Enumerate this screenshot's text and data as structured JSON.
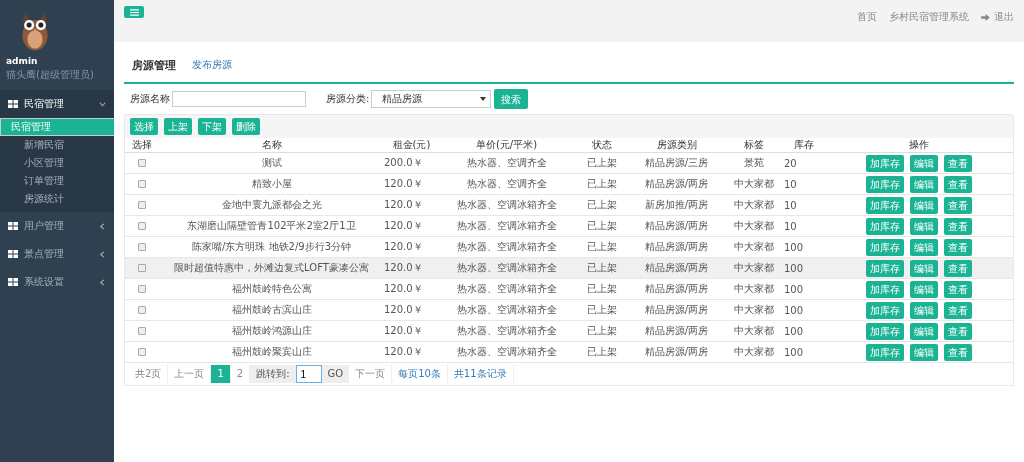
{
  "sidebar": {
    "user": {
      "name": "admin",
      "role": "猫头鹰(超级管理员)"
    },
    "menu": [
      {
        "label": "民宿管理",
        "expanded": true,
        "children": [
          {
            "label": "民宿管理",
            "selected": true
          },
          {
            "label": "新增民宿",
            "selected": false
          },
          {
            "label": "小区管理",
            "selected": false
          },
          {
            "label": "订单管理",
            "selected": false
          },
          {
            "label": "房源统计",
            "selected": false
          }
        ]
      },
      {
        "label": "用户管理",
        "expanded": false
      },
      {
        "label": "景点管理",
        "expanded": false
      },
      {
        "label": "系统设置",
        "expanded": false
      }
    ]
  },
  "topbar": {
    "links": [
      "首页",
      "乡村民宿管理系统"
    ],
    "logout": "退出"
  },
  "page": {
    "title": "房源管理",
    "tab_link": "发布房源"
  },
  "search": {
    "name_label": "房源名称",
    "category_label": "房源分类:",
    "category_value": "精品房源",
    "button": "搜索"
  },
  "actions": [
    "选择",
    "上架",
    "下架",
    "删除"
  ],
  "table": {
    "columns": [
      "选择",
      "名称",
      "租金(元)",
      "单价(元/平米)",
      "状态",
      "房源类别",
      "标签",
      "库存",
      "操作"
    ],
    "rows": [
      {
        "checked": false,
        "highlighted": false,
        "name": "测试",
        "rent": "200.0￥",
        "price": "热水器、空调齐全",
        "status": "已上架",
        "type": "精品房源/三房",
        "tag": "景苑",
        "stock": "20",
        "buttons": [
          "加库存",
          "编辑",
          "查看"
        ]
      },
      {
        "checked": false,
        "highlighted": false,
        "name": "精致小屋",
        "rent": "120.0￥",
        "price": "热水器、空调齐全",
        "status": "已上架",
        "type": "精品房源/两房",
        "tag": "中大家都",
        "stock": "10",
        "buttons": [
          "加库存",
          "编辑",
          "查看"
        ]
      },
      {
        "checked": false,
        "highlighted": false,
        "name": "金地中寰九派都会之光",
        "rent": "120.0￥",
        "price": "热水器、空调冰箱齐全",
        "status": "已上架",
        "type": "新房加推/两房",
        "tag": "中大家都",
        "stock": "10",
        "buttons": [
          "加库存",
          "编辑",
          "查看"
        ]
      },
      {
        "checked": false,
        "highlighted": false,
        "name": "东湖磨山隔壁管青102平米2室2厅1卫",
        "rent": "120.0￥",
        "price": "热水器、空调冰箱齐全",
        "status": "已上架",
        "type": "精品房源/两房",
        "tag": "中大家都",
        "stock": "10",
        "buttons": [
          "加库存",
          "编辑",
          "查看"
        ]
      },
      {
        "checked": false,
        "highlighted": false,
        "name": "陈家嘴/东方明珠 地铁2/9步行3分钟",
        "rent": "120.0￥",
        "price": "热水器、空调冰箱齐全",
        "status": "已上架",
        "type": "精品房源/两房",
        "tag": "中大家都",
        "stock": "100",
        "buttons": [
          "加库存",
          "编辑",
          "查看"
        ]
      },
      {
        "checked": false,
        "highlighted": true,
        "name": "限时超值特惠中，外滩边复式LOFT豪凑公寓",
        "rent": "120.0￥",
        "price": "热水器、空调冰箱齐全",
        "status": "已上架",
        "type": "精品房源/两房",
        "tag": "中大家都",
        "stock": "100",
        "buttons": [
          "加库存",
          "编辑",
          "查看"
        ]
      },
      {
        "checked": false,
        "highlighted": false,
        "name": "福州鼓岭特色公寓",
        "rent": "120.0￥",
        "price": "热水器、空调冰箱齐全",
        "status": "已上架",
        "type": "精品房源/两房",
        "tag": "中大家都",
        "stock": "100",
        "buttons": [
          "加库存",
          "编辑",
          "查看"
        ]
      },
      {
        "checked": false,
        "highlighted": false,
        "name": "福州鼓岭古滨山庄",
        "rent": "120.0￥",
        "price": "热水器、空调冰箱齐全",
        "status": "已上架",
        "type": "精品房源/两房",
        "tag": "中大家都",
        "stock": "100",
        "buttons": [
          "加库存",
          "编辑",
          "查看"
        ]
      },
      {
        "checked": false,
        "highlighted": false,
        "name": "福州鼓岭鸿源山庄",
        "rent": "120.0￥",
        "price": "热水器、空调冰箱齐全",
        "status": "已上架",
        "type": "精品房源/两房",
        "tag": "中大家都",
        "stock": "100",
        "buttons": [
          "加库存",
          "编辑",
          "查看"
        ]
      },
      {
        "checked": false,
        "highlighted": false,
        "name": "福州鼓岭聚宾山庄",
        "rent": "120.0￥",
        "price": "热水器、空调冰箱齐全",
        "status": "已上架",
        "type": "精品房源/两房",
        "tag": "中大家都",
        "stock": "100",
        "buttons": [
          "加库存",
          "编辑",
          "查看"
        ]
      }
    ]
  },
  "pagination": {
    "total_pages": "共2页",
    "prev": "上一页",
    "pages": [
      {
        "label": "1",
        "selected": true
      },
      {
        "label": "2",
        "selected": false
      }
    ],
    "jump_label": "跳转到:",
    "jump_value": "1",
    "go": "GO",
    "next": "下一页",
    "per_page": "每页10条",
    "total": "共11条记录"
  }
}
